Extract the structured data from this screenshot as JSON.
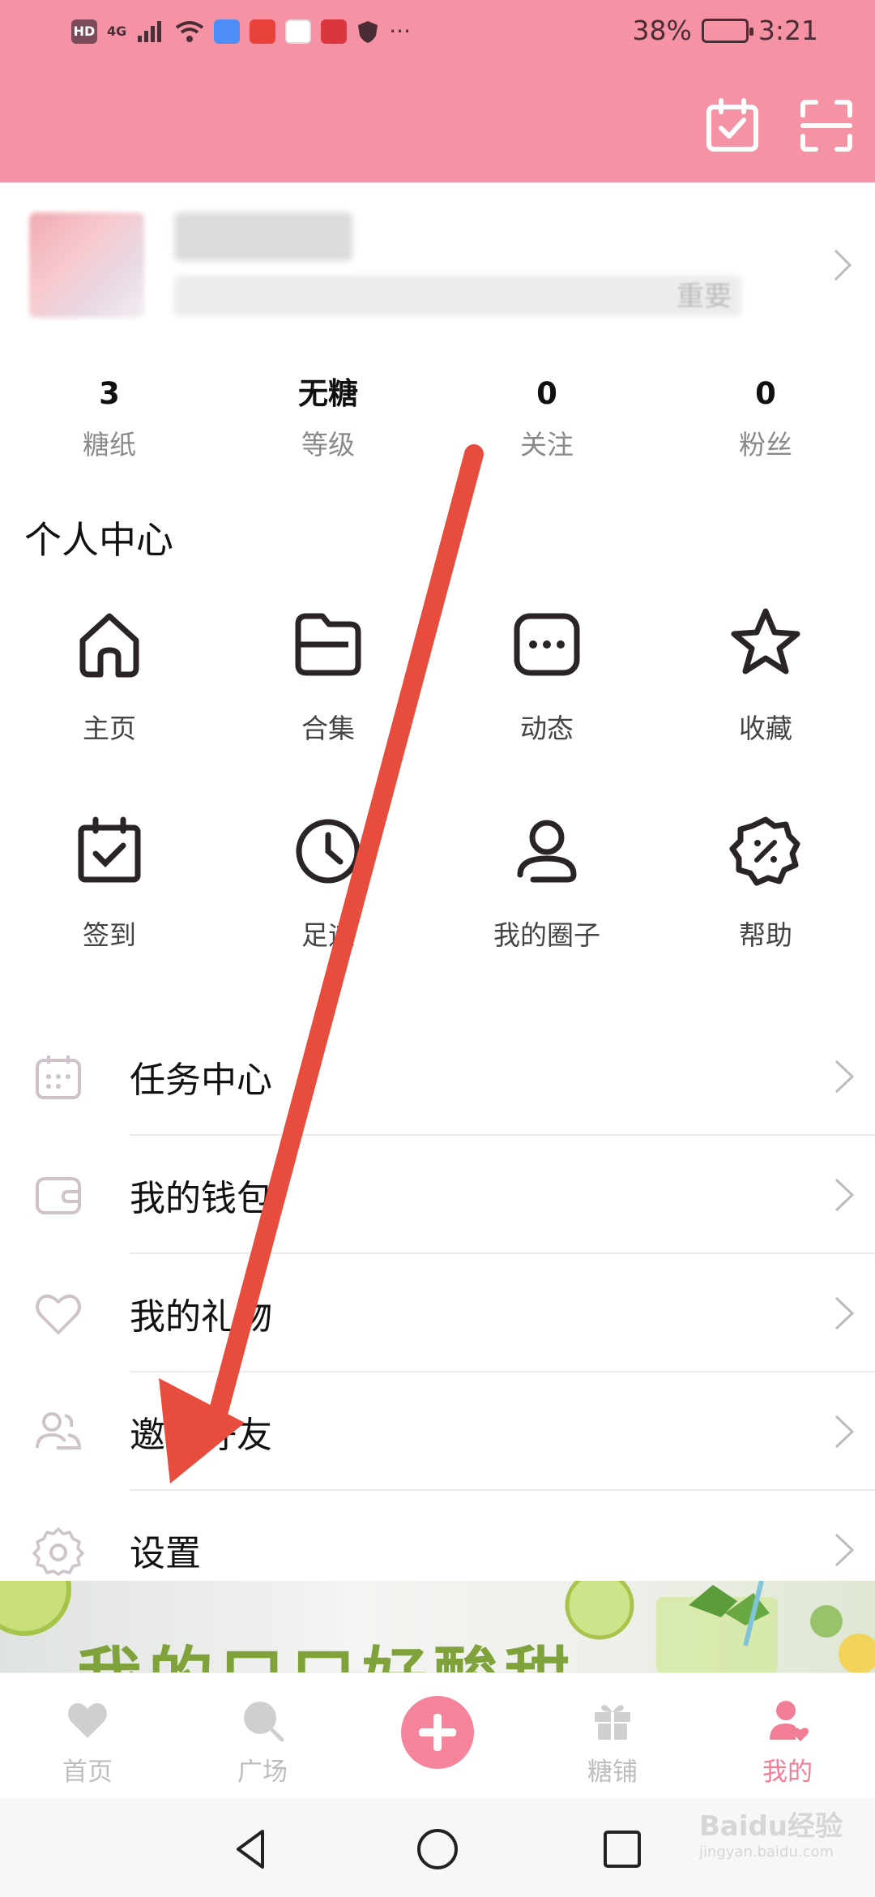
{
  "status_bar": {
    "battery": "38%",
    "time": "3:21",
    "network": "4G"
  },
  "colors": {
    "header": "#F593A4",
    "accent": "#F27E95",
    "arrow": "#E84C3D"
  },
  "profile": {
    "nickname_partial": "重要"
  },
  "stats": [
    {
      "value": "3",
      "label": "糖纸"
    },
    {
      "value": "无糖",
      "label": "等级"
    },
    {
      "value": "0",
      "label": "关注"
    },
    {
      "value": "0",
      "label": "粉丝"
    }
  ],
  "section_title": "个人中心",
  "grid": [
    {
      "label": "主页",
      "icon": "home-icon"
    },
    {
      "label": "合集",
      "icon": "folder-icon"
    },
    {
      "label": "动态",
      "icon": "chat-icon"
    },
    {
      "label": "收藏",
      "icon": "star-icon"
    },
    {
      "label": "签到",
      "icon": "calendar-check-icon"
    },
    {
      "label": "足迹",
      "icon": "clock-icon"
    },
    {
      "label": "我的圈子",
      "icon": "user-icon"
    },
    {
      "label": "帮助",
      "icon": "badge-percent-icon"
    }
  ],
  "menu": [
    {
      "label": "任务中心",
      "icon": "calendar-icon"
    },
    {
      "label": "我的钱包",
      "icon": "wallet-icon"
    },
    {
      "label": "我的礼物",
      "icon": "heart-icon"
    },
    {
      "label": "邀请好友",
      "icon": "friends-icon"
    },
    {
      "label": "设置",
      "icon": "gear-icon"
    }
  ],
  "banner": {
    "text": "我的口口好酸甜"
  },
  "tabs": [
    {
      "label": "首页",
      "icon": "heart-icon"
    },
    {
      "label": "广场",
      "icon": "search-icon"
    },
    {
      "label": "",
      "icon": "plus-icon"
    },
    {
      "label": "糖铺",
      "icon": "gift-icon"
    },
    {
      "label": "我的",
      "icon": "user-icon"
    }
  ],
  "watermark": {
    "text": "Baidu经验",
    "sub": "jingyan.baidu.com"
  }
}
